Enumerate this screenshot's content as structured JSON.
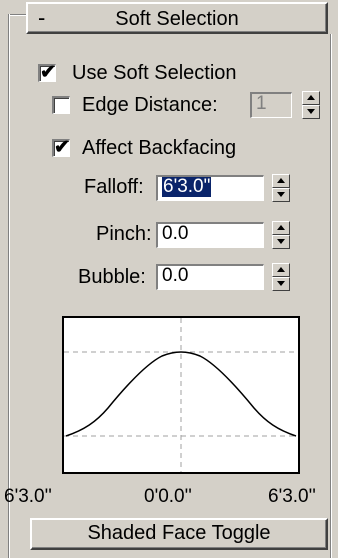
{
  "rollout": {
    "collapse_symbol": "-",
    "title": "Soft Selection"
  },
  "checkboxes": {
    "use_soft_selection": {
      "label": "Use Soft Selection",
      "checked": true,
      "mark": "✔"
    },
    "edge_distance": {
      "label": "Edge Distance:",
      "checked": false,
      "mark": "",
      "value": "1"
    },
    "affect_backfacing": {
      "label": "Affect Backfacing",
      "checked": true,
      "mark": "✔"
    }
  },
  "params": {
    "falloff": {
      "label": "Falloff:",
      "value": "6'3.0\""
    },
    "pinch": {
      "label": "Pinch:",
      "value": "0.0"
    },
    "bubble": {
      "label": "Bubble:",
      "value": "0.0"
    }
  },
  "graph": {
    "ticks": {
      "left": "6'3.0''",
      "center": "0'0.0''",
      "right": "6'3.0''"
    }
  },
  "buttons": {
    "shaded_face_toggle": "Shaded Face Toggle"
  }
}
